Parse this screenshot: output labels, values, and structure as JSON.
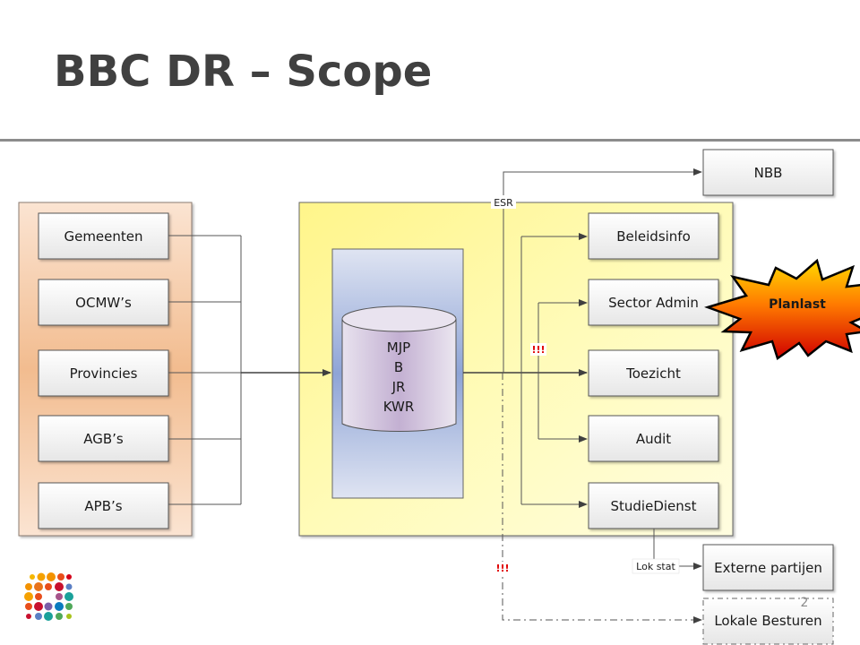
{
  "slide": {
    "title": "BBC DR – Scope",
    "page_number": "2"
  },
  "sources": {
    "items": [
      {
        "label": "Gemeenten"
      },
      {
        "label": "OCMW’s"
      },
      {
        "label": "Provincies"
      },
      {
        "label": "AGB’s"
      },
      {
        "label": "APB’s"
      }
    ]
  },
  "database": {
    "lines": [
      "MJP",
      "B",
      "JR",
      "KWR"
    ]
  },
  "connectors": {
    "esr_label": "ESR",
    "lok_stat_label": "Lok stat",
    "warning_label": "!!!"
  },
  "consumers": {
    "items": [
      {
        "label": "Beleidsinfo"
      },
      {
        "label": "Sector Admin"
      },
      {
        "label": "Toezicht"
      },
      {
        "label": "Audit"
      },
      {
        "label": "StudieDienst"
      }
    ]
  },
  "external": {
    "nbb": "NBB",
    "externe_partijen": "Externe partijen",
    "lokale_besturen": "Lokale Besturen"
  },
  "callout": {
    "label": "Planlast"
  },
  "colors": {
    "source_panel": "#f4c49c",
    "yellow_panel": "#fffaa8",
    "db_panel": "#b6c3e2",
    "warning": "#e00000"
  }
}
